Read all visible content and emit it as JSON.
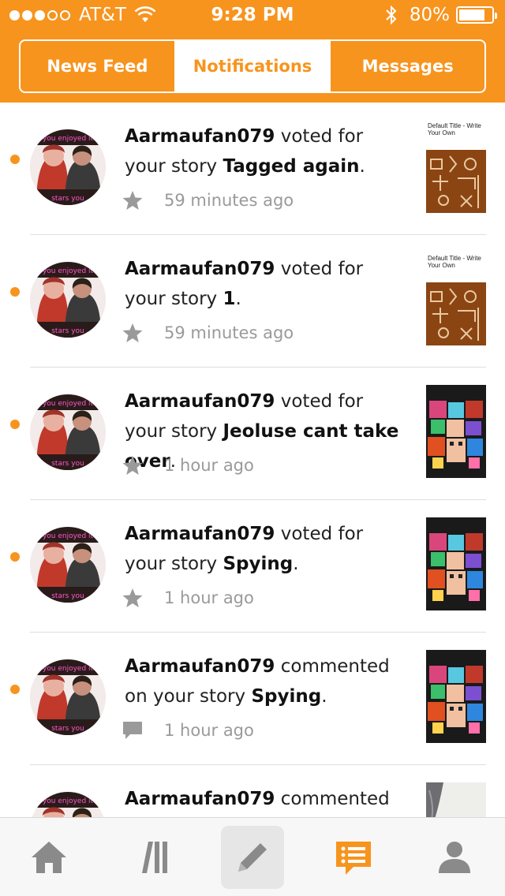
{
  "status_bar": {
    "carrier": "AT&T",
    "time": "9:28 PM",
    "battery": "80%",
    "battery_level": 0.8,
    "signal_bars_filled": 3,
    "signal_bars_total": 5
  },
  "tabs": [
    {
      "label": "News Feed",
      "active": false
    },
    {
      "label": "Notifications",
      "active": true
    },
    {
      "label": "Messages",
      "active": false
    }
  ],
  "notifications": [
    {
      "user": "Aarmaufan079",
      "action_before": " voted for your story ",
      "story": "Tagged again",
      "action_after": ".",
      "time": "59 minutes ago",
      "icon": "star-icon",
      "cover": "brown-pattern",
      "cover_title": "Default Title - Write Your Own"
    },
    {
      "user": "Aarmaufan079",
      "action_before": " voted for your story ",
      "story": "1",
      "action_after": ".",
      "time": "59 minutes ago",
      "icon": "star-icon",
      "cover": "brown-pattern",
      "cover_title": "Default Title - Write Your Own"
    },
    {
      "user": "Aarmaufan079",
      "action_before": " voted for your story ",
      "story": "Jeoluse cant take over",
      "action_after": ".",
      "time": "1 hour ago",
      "icon": "star-icon",
      "cover": "game-art",
      "cover_title": ""
    },
    {
      "user": "Aarmaufan079",
      "action_before": " voted for your story ",
      "story": "Spying",
      "action_after": ".",
      "time": "1 hour ago",
      "icon": "star-icon",
      "cover": "game-art",
      "cover_title": ""
    },
    {
      "user": "Aarmaufan079",
      "action_before": " commented on your story ",
      "story": "Spying",
      "action_after": ".",
      "time": "1 hour ago",
      "icon": "comment-icon",
      "cover": "game-art",
      "cover_title": ""
    },
    {
      "user": "Aarmaufan079",
      "action_before": " commented",
      "story": "",
      "action_after": "",
      "time": "",
      "icon": "comment-icon",
      "cover": "grey-photo",
      "cover_title": ""
    }
  ],
  "colors": {
    "accent": "#f7941e",
    "unread_dot": "#f7941e",
    "meta_grey": "#9a9a9a",
    "separator": "#dedede"
  },
  "bottom_nav": [
    {
      "name": "home",
      "icon": "home-icon",
      "active": false
    },
    {
      "name": "library",
      "icon": "library-icon",
      "active": false
    },
    {
      "name": "write",
      "icon": "pencil-icon",
      "active": false
    },
    {
      "name": "notifications",
      "icon": "notifications-icon",
      "active": true
    },
    {
      "name": "profile",
      "icon": "profile-icon",
      "active": false
    }
  ]
}
